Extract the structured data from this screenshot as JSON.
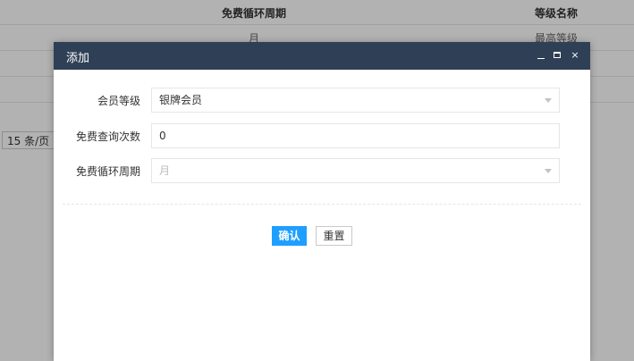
{
  "background": {
    "columns": [
      "免费循环周期",
      "等级名称"
    ],
    "rows": [
      [
        "月",
        "最高等级"
      ],
      [
        "",
        ""
      ],
      [
        "",
        ""
      ],
      [
        "",
        ""
      ]
    ],
    "pager": {
      "page_size": "15 条/页"
    }
  },
  "dialog": {
    "title": "添加",
    "controls": {
      "minimize": "minimize-icon",
      "maximize": "maximize-icon",
      "close": "×"
    },
    "fields": [
      {
        "label": "会员等级",
        "value": "银牌会员",
        "type": "select"
      },
      {
        "label": "免费查询次数",
        "value": "0",
        "type": "text"
      },
      {
        "label": "免费循环周期",
        "value": "月",
        "type": "select-disabled"
      }
    ],
    "buttons": {
      "confirm": "确认",
      "reset": "重置"
    }
  },
  "colors": {
    "title_bar": "#2f4056",
    "primary_button": "#1e9fff",
    "overlay": "rgba(0,0,0,0.3)"
  }
}
